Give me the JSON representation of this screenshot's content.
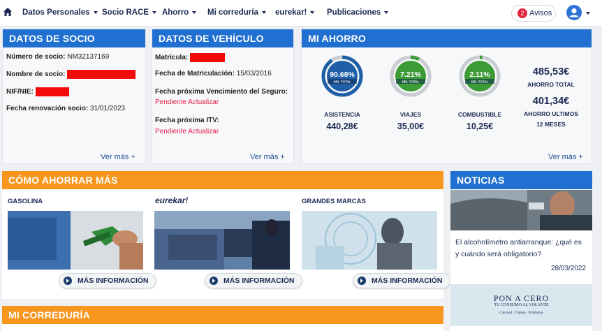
{
  "nav": {
    "items": [
      "Datos Personales",
      "Socio RACE",
      "Ahorro",
      "Mi correduría",
      "eurekar!",
      "Publicaciones"
    ],
    "avisos_count": "2",
    "avisos_label": "Avisos"
  },
  "socio": {
    "title": "DATOS DE SOCIO",
    "numero_label": "Número de socio:",
    "numero_value": "NM32137169",
    "nombre_label": "Nombre de socio:",
    "nif_label": "NIF/NIE:",
    "renovacion_label": "Fecha renovación socio:",
    "renovacion_value": "31/01/2023",
    "ver_mas": "Ver más +"
  },
  "vehiculo": {
    "title": "DATOS DE VEHÍCULO",
    "matricula_label": "Matrícula:",
    "fecha_mat_label": "Fecha de Matriculación:",
    "fecha_mat_value": "15/03/2016",
    "seguro_label": "Fecha próxima Vencimiento del Seguro:",
    "seguro_value": "Pendiente Actualizar",
    "itv_label": "Fecha próxima ITV:",
    "itv_value": "Pendiente Actualizar",
    "ver_mas": "Ver más +"
  },
  "ahorro": {
    "title": "MI AHORRO",
    "donuts": [
      {
        "pct_label": "90.68%",
        "sub": "DEL TOTAL",
        "pct": 90.68,
        "name": "ASISTENCIA",
        "amount": "440,28€",
        "color": "#1f5fa8"
      },
      {
        "pct_label": "7.21%",
        "sub": "DEL TOTAL",
        "pct": 7.21,
        "name": "VIAJES",
        "amount": "35,00€",
        "color": "#3c9b35"
      },
      {
        "pct_label": "2.11%",
        "sub": "DEL TOTAL",
        "pct": 2.11,
        "name": "COMBUSTIBLE",
        "amount": "10,25€",
        "color": "#3c9b35"
      }
    ],
    "total_value": "485,53€",
    "total_label": "AHORRO TOTAL",
    "ult_value": "401,34€",
    "ult_label": "AHORRO ULTIMOS",
    "ult_label2": "12 MESES",
    "ver_mas": "Ver más +"
  },
  "como": {
    "title": "CÓMO AHORRAR MÁS",
    "cats": [
      {
        "title": "GASOLINA",
        "button": "MÁS INFORMACIÓN"
      },
      {
        "title": "eurekar!",
        "button": "MÁS INFORMACIÓN"
      },
      {
        "title": "GRANDES MARCAS",
        "button": "MÁS INFORMACIÓN"
      }
    ]
  },
  "noticias": {
    "title": "NOTICIAS",
    "headline": "El alcoholímetro antiarranque: ¿qué es y cuándo será obligatorio?",
    "date": "28/03/2022",
    "ad_title": "PON A CERO",
    "ad_sub": "TU CONSUMO AL VOLANTE",
    "ad_small": "Calculad · Trabajo · Problemas"
  },
  "correduria": {
    "title": "MI CORREDURÍA"
  }
}
